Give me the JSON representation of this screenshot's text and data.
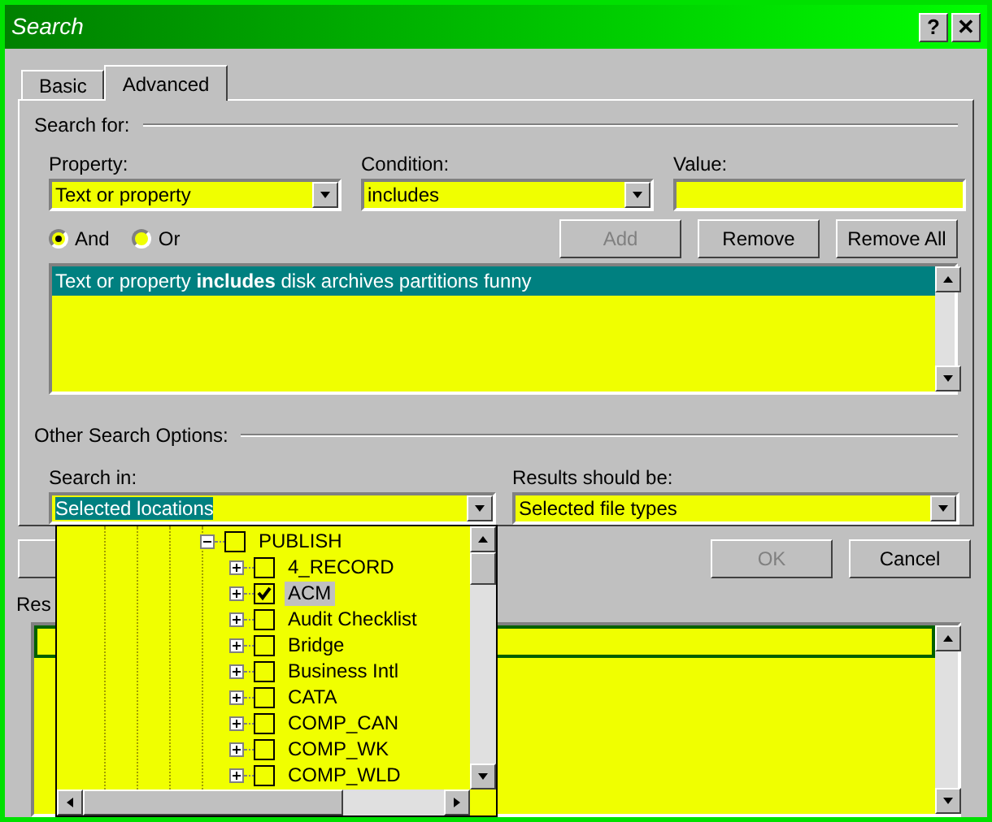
{
  "window": {
    "title": "Search",
    "title_buttons": [
      {
        "label": "?"
      },
      {
        "label": "✕"
      }
    ]
  },
  "tabs": [
    {
      "label": "Basic",
      "selected": false
    },
    {
      "label": "Advanced",
      "selected": true
    }
  ],
  "search_for": {
    "heading": "Search for:",
    "property": {
      "label": "Property:",
      "value": "Text or property"
    },
    "condition": {
      "label": "Condition:",
      "value": "includes"
    },
    "value": {
      "label": "Value:"
    },
    "operators": [
      {
        "label": "And",
        "selected": true
      },
      {
        "label": "Or",
        "selected": false
      }
    ],
    "buttons": [
      {
        "label": "Add",
        "disabled": true
      },
      {
        "label": "Remove",
        "disabled": false
      },
      {
        "label": "Remove All",
        "disabled": false
      }
    ],
    "criteria": [
      {
        "text": "Text or property **includes** disk archives partitions funny",
        "selected": true
      }
    ]
  },
  "other_options": {
    "heading": "Other Search Options:",
    "search_in": {
      "label": "Search in:",
      "value": "Selected locations"
    },
    "results_should_be": {
      "label": "Results should be:",
      "value": "Selected file types"
    }
  },
  "dialog_buttons": [
    {
      "label": "OK",
      "disabled": true
    },
    {
      "label": "Cancel",
      "disabled": false
    }
  ],
  "results": {
    "label": "Res"
  },
  "location_tree": [
    {
      "label": "PUBLISH",
      "expanded": true,
      "checked": false,
      "selected": false,
      "children": [
        {
          "label": "4_RECORD",
          "expanded": false,
          "checked": false,
          "selected": false
        },
        {
          "label": "ACM",
          "expanded": false,
          "checked": true,
          "selected": true
        },
        {
          "label": "Audit Checklist",
          "expanded": false,
          "checked": false,
          "selected": false
        },
        {
          "label": "Bridge",
          "expanded": false,
          "checked": false,
          "selected": false
        },
        {
          "label": "Business Intl",
          "expanded": false,
          "checked": false,
          "selected": false
        },
        {
          "label": "CATA",
          "expanded": false,
          "checked": false,
          "selected": false
        },
        {
          "label": "COMP_CAN",
          "expanded": false,
          "checked": false,
          "selected": false
        },
        {
          "label": "COMP_WK",
          "expanded": false,
          "checked": false,
          "selected": false
        },
        {
          "label": "COMP_WLD",
          "expanded": false,
          "checked": false,
          "selected": false
        }
      ]
    }
  ]
}
